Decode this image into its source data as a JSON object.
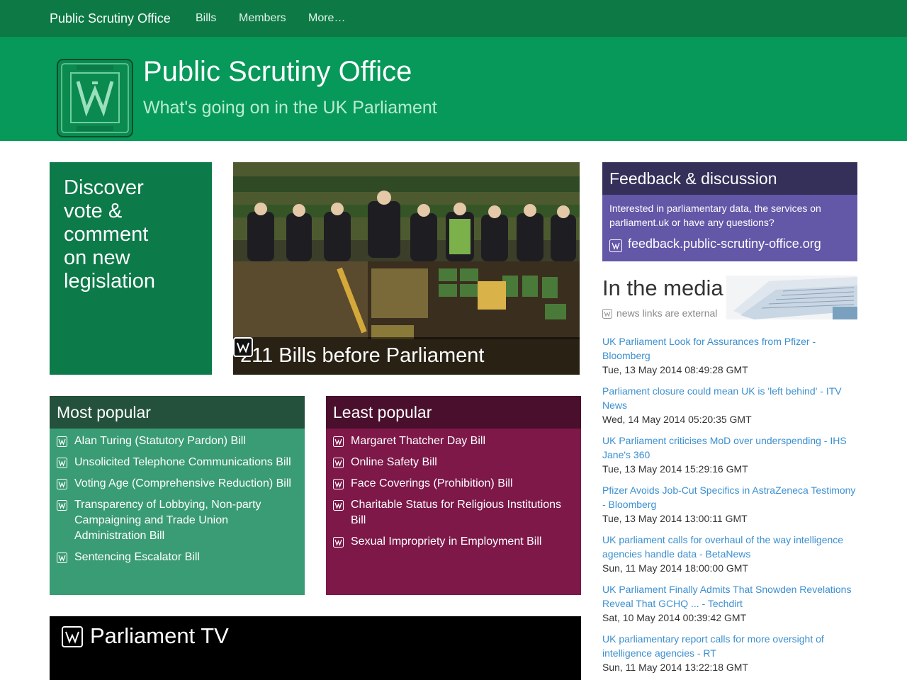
{
  "navbar": {
    "brand": "Public Scrutiny Office",
    "links": [
      "Bills",
      "Members",
      "More…"
    ]
  },
  "header": {
    "title": "Public Scrutiny Office",
    "tagline": "What's going on in the UK Parliament"
  },
  "discover": {
    "lines": [
      "Discover",
      "vote &",
      "comment",
      "on new",
      "legislation"
    ]
  },
  "hero": {
    "caption": "211 Bills before Parliament"
  },
  "most_popular": {
    "title": "Most popular",
    "items": [
      "Alan Turing (Statutory Pardon) Bill",
      "Unsolicited Telephone Communications Bill",
      "Voting Age (Comprehensive Reduction) Bill",
      "Transparency of Lobbying, Non-party Campaigning and Trade Union Administration Bill",
      "Sentencing Escalator Bill"
    ]
  },
  "least_popular": {
    "title": "Least popular",
    "items": [
      "Margaret Thatcher Day Bill",
      "Online Safety Bill",
      "Face Coverings (Prohibition) Bill",
      "Charitable Status for Religious Institutions Bill",
      "Sexual Impropriety in Employment Bill"
    ]
  },
  "tv": {
    "title": "Parliament TV"
  },
  "feedback": {
    "title": "Feedback & discussion",
    "text": "Interested in parliamentary data, the services on parliament.uk or have any questions?",
    "link": "feedback.public-scrutiny-office.org"
  },
  "media": {
    "title": "In the media",
    "note": "news links are external",
    "items": [
      {
        "headline": "UK Parliament Look for Assurances from Pfizer - Bloomberg",
        "date": "Tue, 13 May 2014 08:49:28 GMT"
      },
      {
        "headline": "Parliament closure could mean UK is 'left behind' - ITV News",
        "date": "Wed, 14 May 2014 05:20:35 GMT"
      },
      {
        "headline": "UK Parliament criticises MoD over underspending - IHS Jane's 360",
        "date": "Tue, 13 May 2014 15:29:16 GMT"
      },
      {
        "headline": "Pfizer Avoids Job-Cut Specifics in AstraZeneca Testimony - Bloomberg",
        "date": "Tue, 13 May 2014 13:00:11 GMT"
      },
      {
        "headline": "UK parliament calls for overhaul of the way intelligence agencies handle data - BetaNews",
        "date": "Sun, 11 May 2014 18:00:00 GMT"
      },
      {
        "headline": "UK Parliament Finally Admits That Snowden Revelations Reveal That GCHQ ... - Techdirt",
        "date": "Sat, 10 May 2014 00:39:42 GMT"
      },
      {
        "headline": "UK parliamentary report calls for more oversight of intelligence agencies - RT",
        "date": "Sun, 11 May 2014 13:22:18 GMT"
      }
    ]
  },
  "colors": {
    "navbar": "#0d7a45",
    "header": "#07995a",
    "most_popular": "#3a9c74",
    "least_popular": "#7d1849",
    "feedback": "#6357a8",
    "link": "#3b8fd0"
  },
  "icons": {
    "logo": "pso-seal-logo",
    "bill": "bill-icon",
    "external": "external-link-icon"
  }
}
